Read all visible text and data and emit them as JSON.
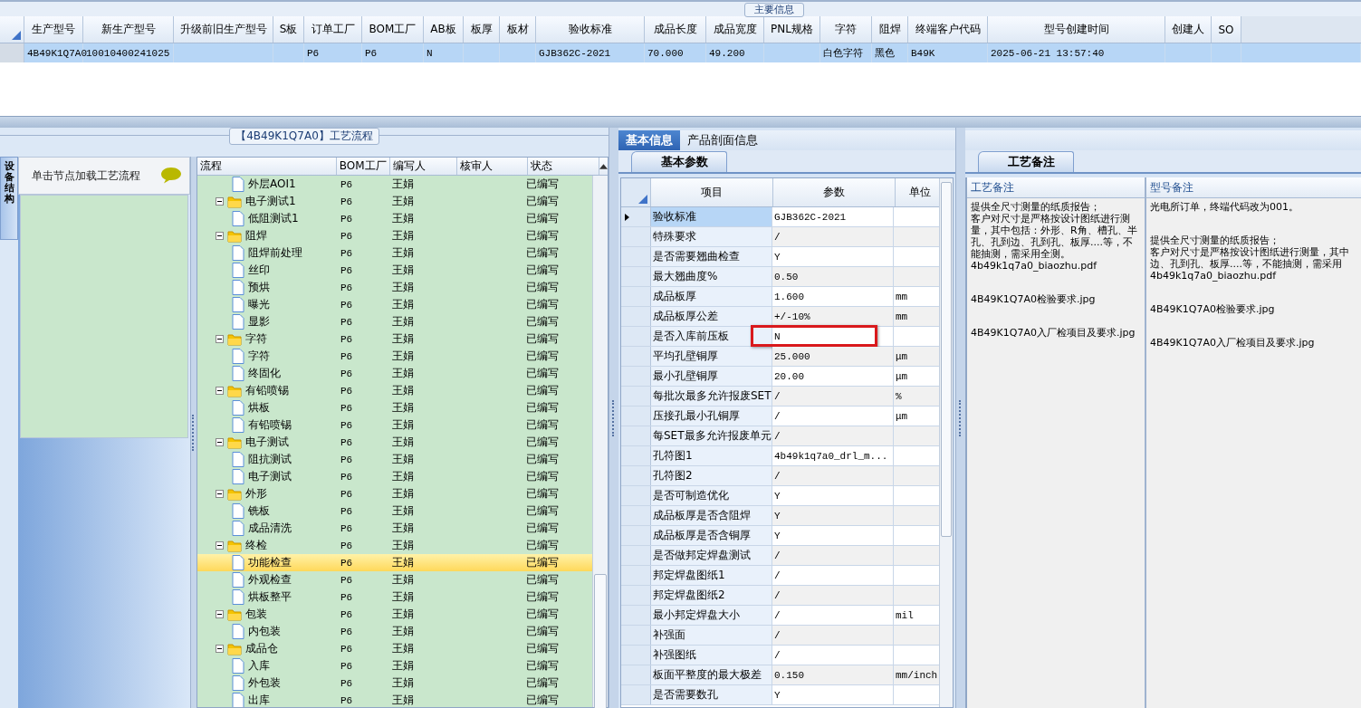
{
  "main_info": {
    "tab": "主要信息",
    "columns": [
      "生产型号",
      "新生产型号",
      "升级前旧生产型号",
      "S板",
      "订单工厂",
      "BOM工厂",
      "AB板",
      "板厚",
      "板材",
      "验收标准",
      "成品长度",
      "成品宽度",
      "PNL规格",
      "字符",
      "阻焊",
      "终端客户代码",
      "型号创建时间",
      "创建人",
      "SO"
    ],
    "rows": [
      {
        "selected": true,
        "cells": [
          "4B49K1Q7A0",
          "10010400241025",
          null,
          null,
          "P6",
          "P6",
          "N",
          null,
          null,
          "GJB362C-2021",
          "70.000",
          "49.200",
          null,
          "白色字符",
          "黑色",
          "B49K",
          "2025-06-21 13:57:40",
          null,
          null
        ]
      }
    ]
  },
  "process_flow": {
    "title": "【4B49K1Q7A0】工艺流程",
    "side_tab": "设备结构",
    "hint": "单击节点加载工艺流程",
    "columns": [
      "流程",
      "BOM工厂",
      "编写人",
      "核审人",
      "状态"
    ],
    "nodes": [
      {
        "name": "外层AOI1",
        "bom": "P6",
        "writer": "王娟",
        "status": "已编写",
        "selected": false
      },
      {
        "name": "电子测试1",
        "bom": "P6",
        "writer": "王娟",
        "status": "已编写",
        "selected": false,
        "expanded": true,
        "children": [
          {
            "name": "低阻测试1",
            "bom": "P6",
            "writer": "王娟",
            "status": "已编写",
            "selected": false
          }
        ]
      },
      {
        "name": "阻焊",
        "bom": "P6",
        "writer": "王娟",
        "status": "已编写",
        "selected": false,
        "expanded": true,
        "children": [
          {
            "name": "阻焊前处理",
            "bom": "P6",
            "writer": "王娟",
            "status": "已编写",
            "selected": false
          },
          {
            "name": "丝印",
            "bom": "P6",
            "writer": "王娟",
            "status": "已编写",
            "selected": false
          },
          {
            "name": "预烘",
            "bom": "P6",
            "writer": "王娟",
            "status": "已编写",
            "selected": false
          },
          {
            "name": "曝光",
            "bom": "P6",
            "writer": "王娟",
            "status": "已编写",
            "selected": false
          },
          {
            "name": "显影",
            "bom": "P6",
            "writer": "王娟",
            "status": "已编写",
            "selected": false
          }
        ]
      },
      {
        "name": "字符",
        "bom": "P6",
        "writer": "王娟",
        "status": "已编写",
        "selected": false,
        "expanded": true,
        "children": [
          {
            "name": "字符",
            "bom": "P6",
            "writer": "王娟",
            "status": "已编写",
            "selected": false
          },
          {
            "name": "终固化",
            "bom": "P6",
            "writer": "王娟",
            "status": "已编写",
            "selected": false
          }
        ]
      },
      {
        "name": "有铅喷锡",
        "bom": "P6",
        "writer": "王娟",
        "status": "已编写",
        "selected": false,
        "expanded": true,
        "children": [
          {
            "name": "烘板",
            "bom": "P6",
            "writer": "王娟",
            "status": "已编写",
            "selected": false
          },
          {
            "name": "有铅喷锡",
            "bom": "P6",
            "writer": "王娟",
            "status": "已编写",
            "selected": false
          }
        ]
      },
      {
        "name": "电子测试",
        "bom": "P6",
        "writer": "王娟",
        "status": "已编写",
        "selected": false,
        "expanded": true,
        "children": [
          {
            "name": "阻抗测试",
            "bom": "P6",
            "writer": "王娟",
            "status": "已编写",
            "selected": false
          },
          {
            "name": "电子测试",
            "bom": "P6",
            "writer": "王娟",
            "status": "已编写",
            "selected": false
          }
        ]
      },
      {
        "name": "外形",
        "bom": "P6",
        "writer": "王娟",
        "status": "已编写",
        "selected": false,
        "expanded": true,
        "children": [
          {
            "name": "铣板",
            "bom": "P6",
            "writer": "王娟",
            "status": "已编写",
            "selected": false
          },
          {
            "name": "成品清洗",
            "bom": "P6",
            "writer": "王娟",
            "status": "已编写",
            "selected": false
          }
        ]
      },
      {
        "name": "终检",
        "bom": "P6",
        "writer": "王娟",
        "status": "已编写",
        "selected": false,
        "expanded": true,
        "children": [
          {
            "name": "功能检查",
            "bom": "P6",
            "writer": "王娟",
            "status": "已编写",
            "selected": true
          },
          {
            "name": "外观检查",
            "bom": "P6",
            "writer": "王娟",
            "status": "已编写",
            "selected": false
          },
          {
            "name": "烘板整平",
            "bom": "P6",
            "writer": "王娟",
            "status": "已编写",
            "selected": false
          }
        ]
      },
      {
        "name": "包装",
        "bom": "P6",
        "writer": "王娟",
        "status": "已编写",
        "selected": false,
        "expanded": true,
        "children": [
          {
            "name": "内包装",
            "bom": "P6",
            "writer": "王娟",
            "status": "已编写",
            "selected": false
          }
        ]
      },
      {
        "name": "成品仓",
        "bom": "P6",
        "writer": "王娟",
        "status": "已编写",
        "selected": false,
        "expanded": true,
        "children": [
          {
            "name": "入库",
            "bom": "P6",
            "writer": "王娟",
            "status": "已编写",
            "selected": false
          },
          {
            "name": "外包装",
            "bom": "P6",
            "writer": "王娟",
            "status": "已编写",
            "selected": false
          },
          {
            "name": "出库",
            "bom": "P6",
            "writer": "王娟",
            "status": "已编写",
            "selected": false
          }
        ]
      }
    ]
  },
  "detail": {
    "tabs": [
      {
        "label": "基本信息",
        "selected": true
      },
      {
        "label": "产品剖面信息",
        "selected": false
      }
    ],
    "subtab": "基本参数",
    "columns": [
      "项目",
      "参数",
      "单位"
    ],
    "rows": [
      {
        "item": "验收标准",
        "value": "GJB362C-2021",
        "selected": true,
        "highlighted": false
      },
      {
        "item": "特殊要求",
        "value": "/",
        "selected": false,
        "highlighted": false
      },
      {
        "item": "是否需要翘曲检查",
        "value": "Y",
        "selected": false,
        "highlighted": false
      },
      {
        "item": "最大翘曲度%",
        "value": "0.50",
        "selected": false,
        "highlighted": false
      },
      {
        "item": "成品板厚",
        "value": "1.600",
        "unit": "mm",
        "selected": false,
        "highlighted": false
      },
      {
        "item": "成品板厚公差",
        "value": "+/-10%",
        "unit": "mm",
        "selected": false,
        "highlighted": false
      },
      {
        "item": "是否入库前压板",
        "value": "N",
        "selected": false,
        "highlighted": true
      },
      {
        "item": "平均孔壁铜厚",
        "value": "25.000",
        "unit": "μm",
        "selected": false,
        "highlighted": false
      },
      {
        "item": "最小孔壁铜厚",
        "value": "20.00",
        "unit": "μm",
        "selected": false,
        "highlighted": false
      },
      {
        "item": "每批次最多允许报废SET",
        "value": "/",
        "unit": "%",
        "selected": false,
        "highlighted": false
      },
      {
        "item": "压接孔最小孔铜厚",
        "value": "/",
        "unit": "μm",
        "selected": false,
        "highlighted": false
      },
      {
        "item": "每SET最多允许报废单元",
        "value": "/",
        "selected": false,
        "highlighted": false
      },
      {
        "item": "孔符图1",
        "value": "4b49k1q7a0_drl_m...",
        "selected": false,
        "highlighted": false
      },
      {
        "item": "孔符图2",
        "value": "/",
        "selected": false,
        "highlighted": false
      },
      {
        "item": "是否可制造优化",
        "value": "Y",
        "selected": false,
        "highlighted": false
      },
      {
        "item": "成品板厚是否含阻焊",
        "value": "Y",
        "selected": false,
        "highlighted": false
      },
      {
        "item": "成品板厚是否含铜厚",
        "value": "Y",
        "selected": false,
        "highlighted": false
      },
      {
        "item": "是否做邦定焊盘测试",
        "value": "/",
        "selected": false,
        "highlighted": false
      },
      {
        "item": "邦定焊盘图纸1",
        "value": "/",
        "selected": false,
        "highlighted": false
      },
      {
        "item": "邦定焊盘图纸2",
        "value": "/",
        "selected": false,
        "highlighted": false
      },
      {
        "item": "最小邦定焊盘大小",
        "value": "/",
        "unit": "mil",
        "selected": false,
        "highlighted": false
      },
      {
        "item": "补强面",
        "value": "/",
        "selected": false,
        "highlighted": false
      },
      {
        "item": "补强图纸",
        "value": "/",
        "selected": false,
        "highlighted": false
      },
      {
        "item": "板面平整度的最大极差",
        "value": "0.150",
        "unit": "mm/inch",
        "selected": false,
        "highlighted": false
      },
      {
        "item": "是否需要数孔",
        "value": "Y",
        "selected": false,
        "highlighted": false
      }
    ]
  },
  "notes": {
    "subtab": "工艺备注",
    "columns": [
      {
        "title": "工艺备注",
        "paragraphs": [
          [
            "提供全尺寸测量的纸质报告；",
            "客户对尺寸是严格按设计图纸进行测量，其中包括：外形、R角、槽孔、半孔、孔到边、孔到孔、板厚....等，不能抽测，需采用全测。",
            "4b49k1q7a0_biaozhu.pdf"
          ],
          [
            "4B49K1Q7A0检验要求.jpg"
          ],
          [
            "4B49K1Q7A0入厂检项目及要求.jpg"
          ]
        ]
      },
      {
        "title": "型号备注",
        "paragraphs": [
          [
            "光电所订单，终端代码改为001。"
          ],
          [
            "提供全尺寸测量的纸质报告；",
            "客户对尺寸是严格按设计图纸进行测量，其中",
            "边、孔到孔、板厚....等，不能抽测，需采用",
            "4b49k1q7a0_biaozhu.pdf"
          ],
          [
            "4B49K1Q7A0检验要求.jpg"
          ],
          [
            "4B49K1Q7A0入厂检项目及要求.jpg"
          ]
        ]
      }
    ]
  }
}
